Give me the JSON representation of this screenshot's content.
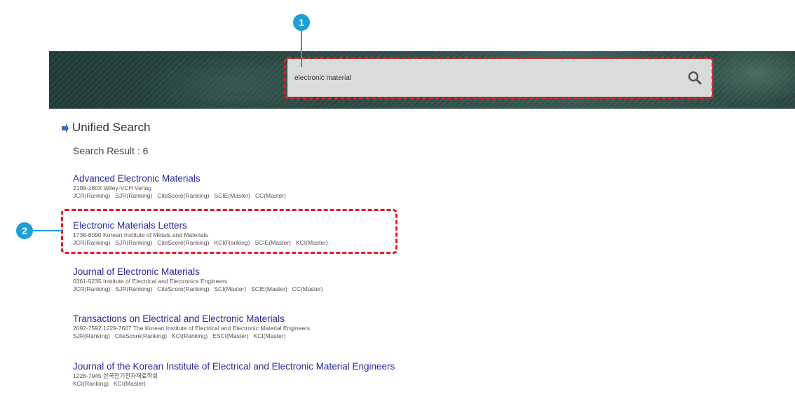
{
  "search": {
    "value": "electronic material"
  },
  "annotations": {
    "callout_1": "1",
    "callout_2": "2"
  },
  "section": {
    "title": "Unified Search",
    "result_count": "Search Result : 6"
  },
  "results": [
    {
      "title": "Advanced Electronic Materials",
      "meta": "2199-160X Wiley-VCH Verlag",
      "cats": [
        "JCR(Ranking)",
        "SJR(Ranking)",
        "CiteScore(Ranking)",
        "SCIE(Master)",
        "CC(Master)"
      ]
    },
    {
      "title": "Electronic Materials Letters",
      "meta": "1738-8090 Korean Institute of Metals and Materials",
      "cats": [
        "JCR(Ranking)",
        "SJR(Ranking)",
        "CiteScore(Ranking)",
        "KCI(Ranking)",
        "SCIE(Master)",
        "KCI(Master)"
      ]
    },
    {
      "title": "Journal of Electronic Materials",
      "meta": "0361-5235 Institute of Electrical and Electronics Engineers",
      "cats": [
        "JCR(Ranking)",
        "SJR(Ranking)",
        "CiteScore(Ranking)",
        "SCI(Master)",
        "SCIE(Master)",
        "CC(Master)"
      ]
    },
    {
      "title": "Transactions on Electrical and Electronic Materials",
      "meta": "2092-7592,1229-7607 The Korean Institute of Electrical and Electronic Material Engineers",
      "cats": [
        "SJR(Ranking)",
        "CiteScore(Ranking)",
        "KCI(Ranking)",
        "ESCI(Master)",
        "KCI(Master)"
      ]
    },
    {
      "title": "Journal of the Korean Institute of Electrical and Electronic Material Engineers",
      "meta": "1226-7945 한국전기전자재료학회",
      "cats": [
        "KCI(Ranking)",
        "KCI(Master)"
      ]
    }
  ],
  "colors": {
    "accent_red": "#e51b24",
    "callout_blue": "#1e9fd8",
    "link": "#2a2a9c"
  }
}
